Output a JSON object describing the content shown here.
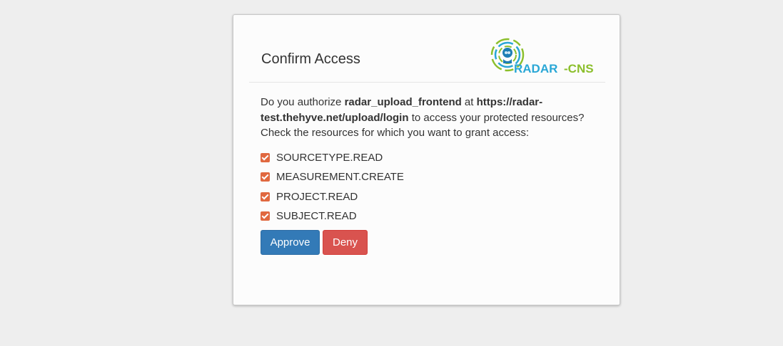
{
  "dialog": {
    "title": "Confirm Access",
    "logo_text_1": "RADAR",
    "logo_text_2": "-CNS",
    "prompt": {
      "p1": "Do you authorize ",
      "client": "radar_upload_frontend",
      "p2": " at ",
      "url": "https://radar-test.thehyve.net/upload/login",
      "p3": " to access your protected resources?",
      "line2": "Check the resources for which you want to grant access:"
    },
    "scopes": [
      {
        "label": "SOURCETYPE.READ",
        "checked": true
      },
      {
        "label": "MEASUREMENT.CREATE",
        "checked": true
      },
      {
        "label": "PROJECT.READ",
        "checked": true
      },
      {
        "label": "SUBJECT.READ",
        "checked": true
      }
    ],
    "approve_label": "Approve",
    "deny_label": "Deny"
  },
  "colors": {
    "approve": "#337ab7",
    "deny": "#d9534f",
    "checkbox": "#e0683f",
    "logo_blue": "#2aa7d6",
    "logo_green": "#8cbf2c"
  }
}
